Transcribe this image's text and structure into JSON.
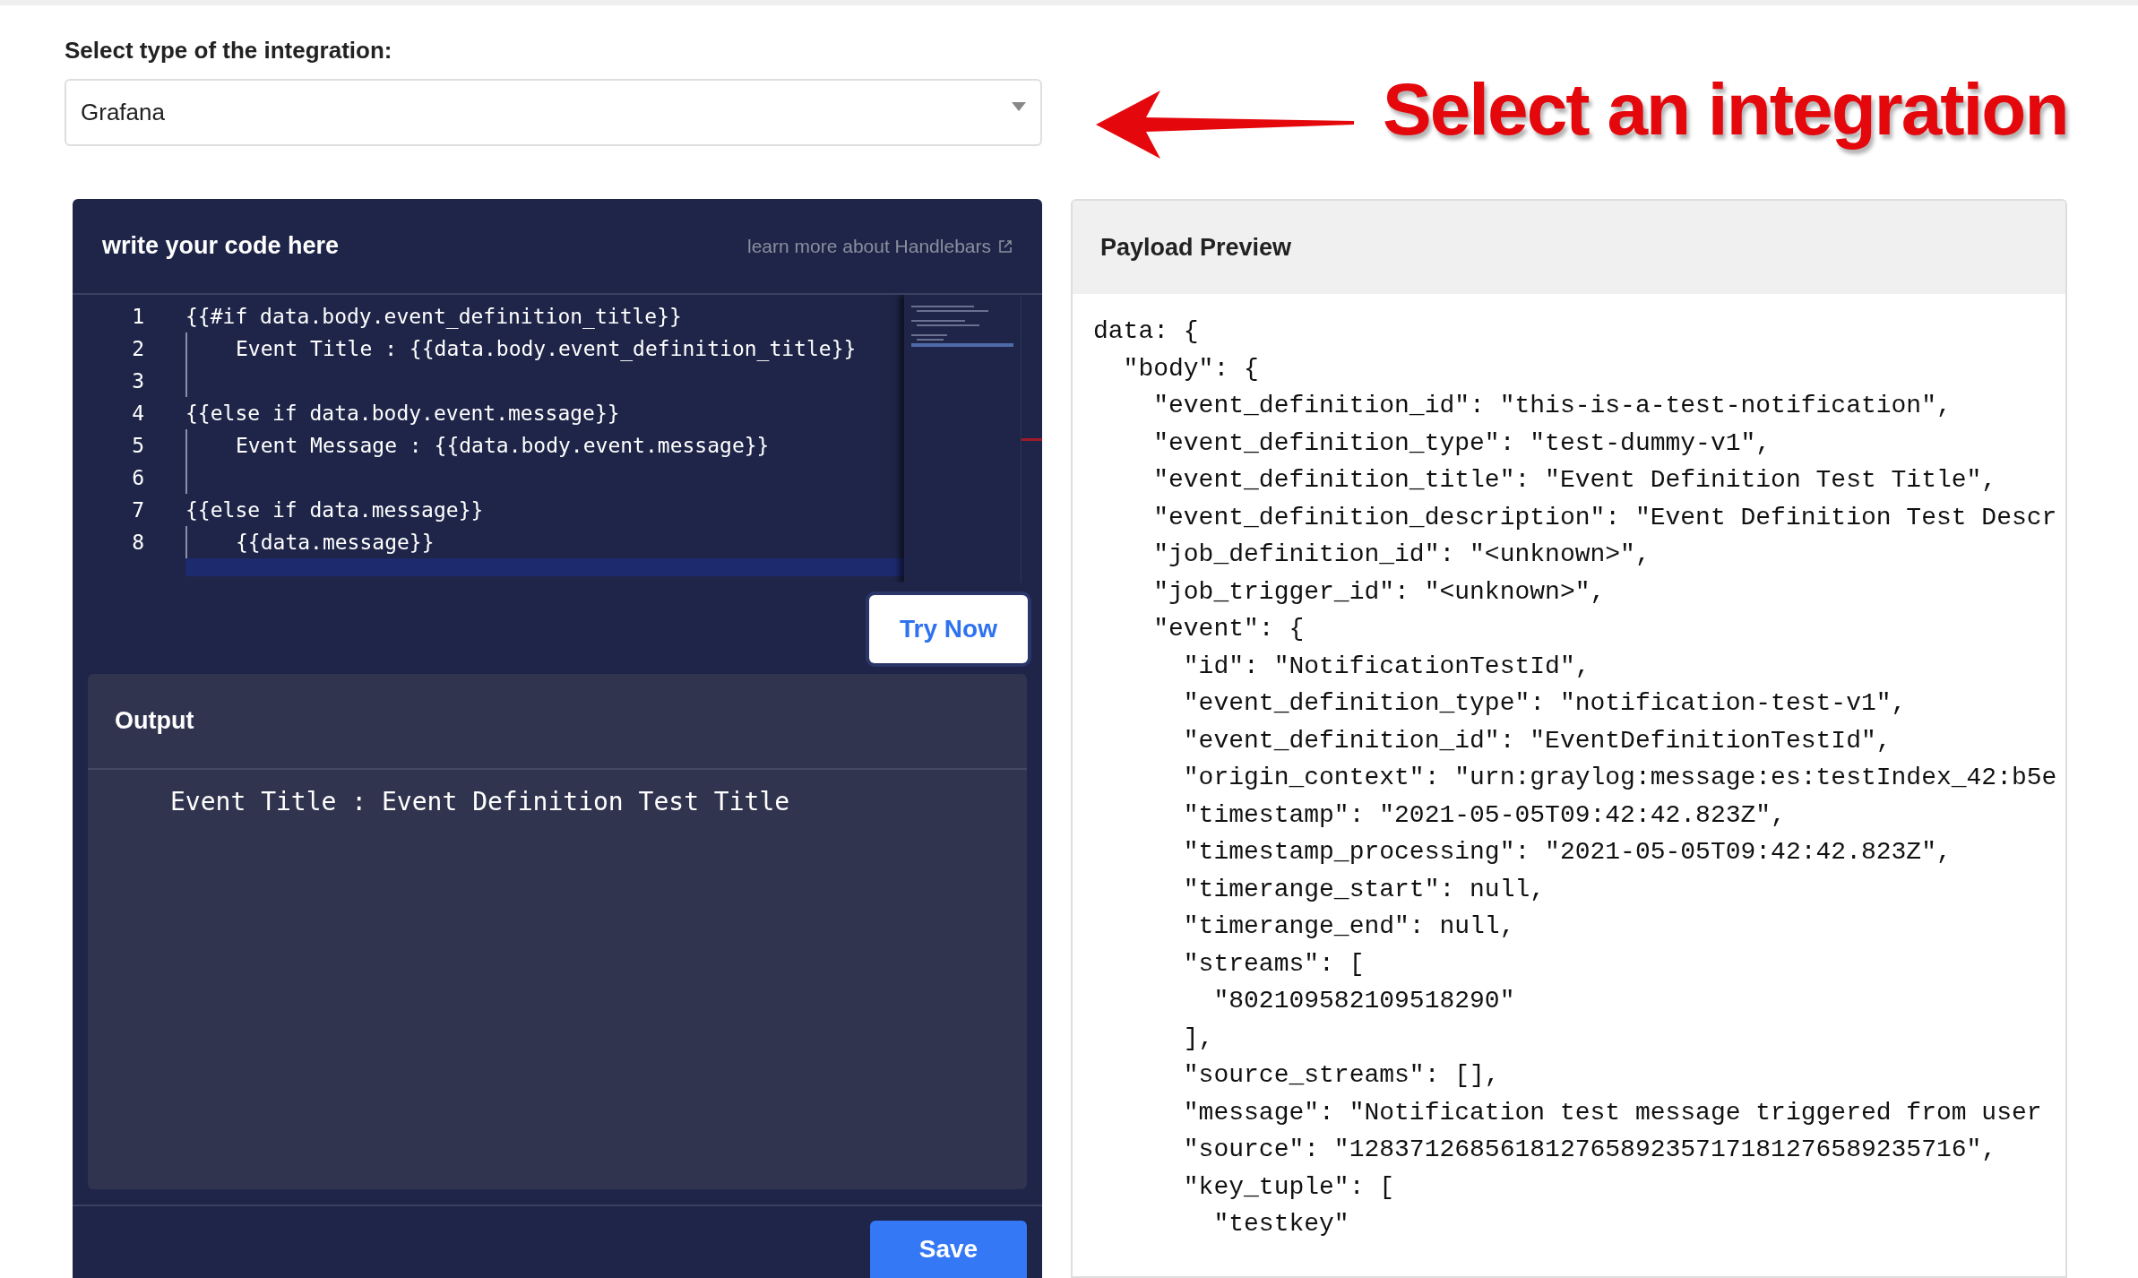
{
  "integration_select": {
    "label": "Select type of the integration:",
    "value": "Grafana"
  },
  "annotation": {
    "text": "Select an integration"
  },
  "editor_panel": {
    "title": "write your code here",
    "help_link": "learn more about Handlebars",
    "lines": [
      {
        "number": "1",
        "kind": "statement",
        "text": "{{#if data.body.event_definition_title}}"
      },
      {
        "number": "2",
        "kind": "nested",
        "text": "Event Title : {{data.body.event_definition_title}}"
      },
      {
        "number": "3",
        "kind": "nested"
      },
      {
        "number": "4",
        "kind": "statement",
        "text": "{{else if data.body.event.message}}"
      },
      {
        "number": "5",
        "kind": "nested",
        "text": "Event Message : {{data.body.event.message}}"
      },
      {
        "number": "6",
        "kind": "nested"
      },
      {
        "number": "7",
        "kind": "statement",
        "text": "{{else if data.message}}"
      },
      {
        "number": "8",
        "kind": "nested",
        "text": "{{data.message}}"
      },
      {
        "kind": "current"
      }
    ],
    "try_button": "Try Now",
    "output": {
      "title": "Output",
      "text": "Event Title : Event Definition Test Title"
    },
    "save_button": "Save"
  },
  "payload_panel": {
    "title": "Payload Preview",
    "lines": [
      "data: {",
      "  \"body\": {",
      "    \"event_definition_id\": \"this-is-a-test-notification\",",
      "    \"event_definition_type\": \"test-dummy-v1\",",
      "    \"event_definition_title\": \"Event Definition Test Title\",",
      "    \"event_definition_description\": \"Event Definition Test Descr",
      "    \"job_definition_id\": \"<unknown>\",",
      "    \"job_trigger_id\": \"<unknown>\",",
      "    \"event\": {",
      "      \"id\": \"NotificationTestId\",",
      "      \"event_definition_type\": \"notification-test-v1\",",
      "      \"event_definition_id\": \"EventDefinitionTestId\",",
      "      \"origin_context\": \"urn:graylog:message:es:testIndex_42:b5e",
      "      \"timestamp\": \"2021-05-05T09:42:42.823Z\",",
      "      \"timestamp_processing\": \"2021-05-05T09:42:42.823Z\",",
      "      \"timerange_start\": null,",
      "      \"timerange_end\": null,",
      "      \"streams\": [",
      "        \"802109582109518290\"",
      "      ],",
      "      \"source_streams\": [],",
      "      \"message\": \"Notification test message triggered from user",
      "      \"source\": \"12837126856181276589235717181276589235716\",",
      "      \"key_tuple\": [",
      "        \"testkey\""
    ]
  }
}
